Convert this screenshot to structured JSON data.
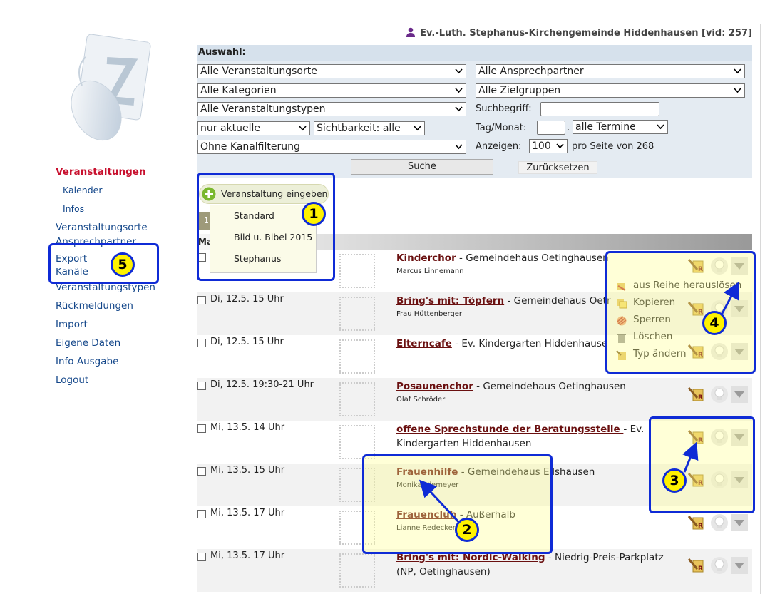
{
  "header": {
    "title": "Ev.-Luth. Stephanus-Kirchengemeinde Hiddenhausen [vid: 257]",
    "user_icon": "user-icon"
  },
  "nav": {
    "items": [
      {
        "label": "Veranstaltungen",
        "active": true
      },
      {
        "label": "Kalender",
        "sub": true
      },
      {
        "label": "Infos",
        "sub": true
      },
      {
        "label": "Veranstaltungsorte"
      },
      {
        "label": "Ansprechpartner"
      },
      {
        "label": "Export"
      },
      {
        "label": "Kanäle"
      },
      {
        "label": "Veranstaltungstypen"
      },
      {
        "label": "Rückmeldungen"
      },
      {
        "label": "Import"
      },
      {
        "label": "Eigene Daten"
      },
      {
        "label": "Info Ausgabe"
      },
      {
        "label": "Logout"
      }
    ]
  },
  "filter": {
    "title": "Auswahl:",
    "orte": "Alle Veranstaltungsorte",
    "ansprechpartner": "Alle Ansprechpartner",
    "kategorien": "Alle Kategorien",
    "zielgruppen": "Alle Zielgruppen",
    "typen": "Alle Veranstaltungstypen",
    "suchbegriff_label": "Suchbegriff:",
    "aktuell": "nur aktuelle",
    "sichtbarkeit": "Sichtbarkeit: alle",
    "tagmonat_label": "Tag/Monat:",
    "termine": "alle Termine",
    "kanal": "Ohne Kanalfilterung",
    "anzeigen_label": "Anzeigen:",
    "anzeigen_value": "100",
    "pro_seite": "pro Seite von 268",
    "suche_button": "Suche",
    "reset_button": "Zurücksetzen"
  },
  "add": {
    "label": "Veranstaltung eingeben",
    "templates": [
      "Standard",
      "Bild u. Bibel 2015",
      "Stephanus"
    ],
    "tab_stub": "1",
    "section_stub": "Ma"
  },
  "events": [
    {
      "date": "",
      "title": "Kinderchor",
      "place": " - Gemeindehaus Oetinghausen",
      "person": "Marcus Linnemann"
    },
    {
      "date": "Di, 12.5. 15 Uhr",
      "title": "Bring's mit: Töpfern",
      "place": " - Gemeindehaus Oetr",
      "person": "Frau Hüttenberger"
    },
    {
      "date": "Di, 12.5. 15 Uhr",
      "title": "Elterncafe",
      "place": " - Ev. Kindergarten Hiddenhause",
      "person": ""
    },
    {
      "date": "Di, 12.5. 19:30-21 Uhr",
      "title": "Posaunenchor",
      "place": " - Gemeindehaus Oetinghausen",
      "person": "Olaf Schröder"
    },
    {
      "date": "Mi, 13.5. 14 Uhr",
      "title": "offene Sprechstunde der Beratungsstelle ",
      "place": "- Ev. Kindergarten Hiddenhausen",
      "person": ""
    },
    {
      "date": "Mi, 13.5. 15 Uhr",
      "title": "Frauenhilfe",
      "place": " - Gemeindehaus Eilshausen",
      "person": "Monika Niemeyer"
    },
    {
      "date": "Mi, 13.5. 17 Uhr",
      "title": "Frauenclub",
      "place": " - Außerhalb",
      "person": "Lianne Redecker"
    },
    {
      "date": "Mi, 13.5. 17 Uhr",
      "title": "Bring's mit: Nordic-Walking",
      "place": " - Niedrig-Preis-Parkplatz (NP, Oetinghausen)",
      "person": ""
    }
  ],
  "context_menu": {
    "items": [
      {
        "label": "aus Reihe herauslösen",
        "icon": "unlink-icon"
      },
      {
        "label": "Kopieren",
        "icon": "copy-icon"
      },
      {
        "label": "Sperren",
        "icon": "lock-icon"
      },
      {
        "label": "Löschen",
        "icon": "trash-icon"
      },
      {
        "label": "Typ ändern",
        "icon": "type-change-icon"
      }
    ]
  },
  "callouts": [
    "1",
    "2",
    "3",
    "4",
    "5"
  ],
  "colors": {
    "accent_red": "#c8102e",
    "link_blue": "#14478a",
    "highlight_yellow": "#fff200",
    "callout_blue": "#0f2bd6"
  }
}
